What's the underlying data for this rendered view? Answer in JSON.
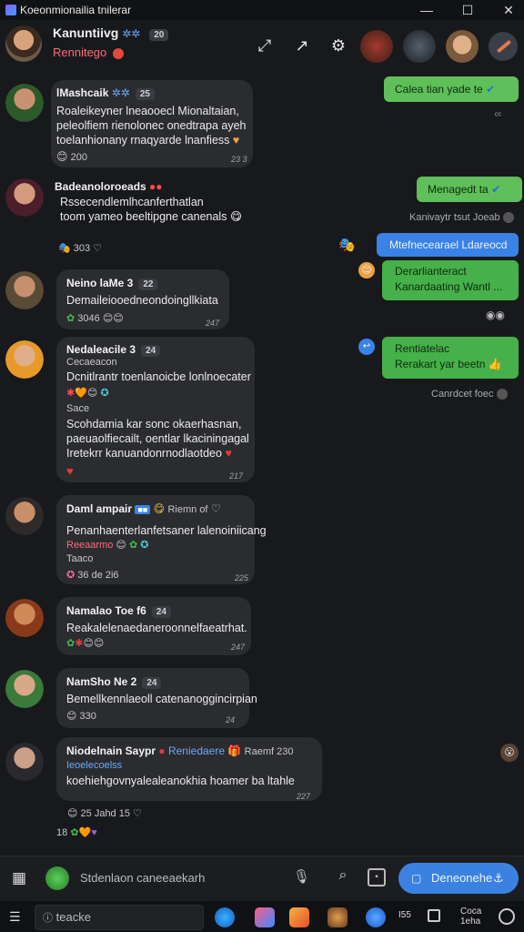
{
  "window": {
    "title": "Koeonmionailia tnilerar"
  },
  "header": {
    "name": "Kanuntiivg",
    "status": "Rennitego",
    "name_pill": "20"
  },
  "messages": [
    {
      "name": "lMashcaik",
      "pill": "25",
      "lines": [
        "Roaleikeyner lneaooecl Mionaltaian,",
        "peleolfiem rienolonec onedtrapa ayeh",
        "toelanhionany rnaqyarde lnanfiess"
      ],
      "reaction_count": "200",
      "time": "23 3"
    },
    {
      "name": "Badeanoloroeads",
      "lines": [
        "Rssecendlemlhcanferthatlan",
        "toom yameo beeltipgne canenals"
      ],
      "reaction_count": "303",
      "time": ""
    },
    {
      "name": "Neino laMe 3",
      "pill": "22",
      "lines": [
        "Demaileiooedneondoingllkiata"
      ],
      "reaction_count": "3046",
      "time": "247"
    },
    {
      "name": "Nedaleacile 3",
      "pill": "24",
      "sub": "Cecaeacon",
      "lines": [
        "Dcnitlrantr toenlanoicbe lonlnoecater"
      ],
      "sub2": "Sace",
      "lines2": [
        "Scohdamia kar sonc okaerhasnan,",
        "paeuaolfiecailt, oentlar lkaciningagal",
        "Iretekrr kanuandonrnodlaotdeo"
      ],
      "time": "217"
    },
    {
      "name": "Daml ampair",
      "pill": "dual",
      "extra": "Riemn of",
      "lines": [
        "Penanhaenterlanfetsaner lalenoiniicang"
      ],
      "sub": "Reeaarmo",
      "sub2": "Taaco",
      "reaction_count": "36 de 2i6",
      "time": "225"
    },
    {
      "name": "Namalao Toe f6",
      "pill": "24",
      "lines": [
        "Reakalelenaedaneroonnelfaeatrhat."
      ],
      "time": "247"
    },
    {
      "name": "NamSho Ne 2",
      "pill": "24",
      "lines": [
        "Bemellkennlaeoll catenanoggincirpian"
      ],
      "reaction_count": "330",
      "time": "24"
    },
    {
      "name": "Niodelnain Saypr",
      "tag": "Reniedaere",
      "extra": "Raemf 230",
      "sub": "Ieoelecoelss",
      "lines": [
        "koehiehgovnyalealeanokhia hoamer ba ltahle"
      ],
      "time": "227"
    }
  ],
  "footer_reactions": {
    "line1": "25 Jahd 15",
    "line2": "18"
  },
  "outgoing": [
    {
      "text": "Calea tian yade te"
    },
    {
      "text": "Menagedt ta"
    },
    {
      "text": "Kanivaytr tsut Joeab"
    },
    {
      "text": "Mtefnecearael Ldareocd"
    },
    {
      "text": "Derarlianteract",
      "text2": "Kanardaating Wantl ..."
    },
    {
      "text": "Rentiatelac",
      "text2": "Rerakart yar beetn"
    },
    {
      "text": "Canrdcet foec"
    }
  ],
  "composer": {
    "placeholder": "Stdenlaon caneeaekarh",
    "send_label": "Deneonehe"
  },
  "taskbar": {
    "search": "teacke",
    "t1": "I55",
    "t2": "Coca",
    "t3": "1eha"
  },
  "colors": {
    "accent_blue": "#3b82e0",
    "outgoing_green": "#5fbf5a",
    "bubble": "#2b2c30",
    "mention_red": "#ff6b7a"
  }
}
